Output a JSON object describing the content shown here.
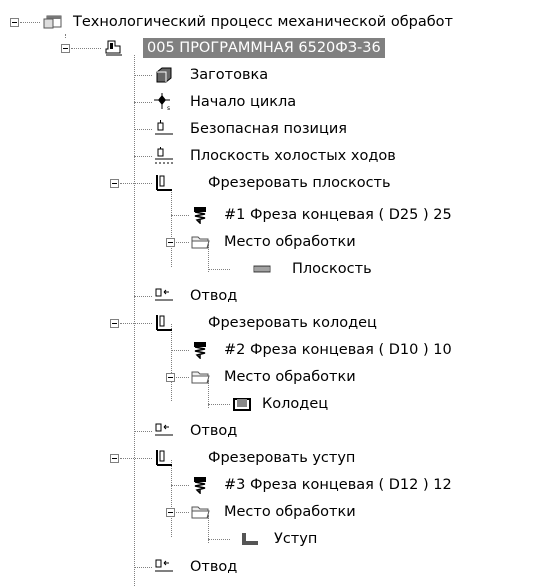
{
  "tree": {
    "root": {
      "label": "Технологический процесс механической обработ"
    },
    "operation": {
      "label": "005  ПРОГРАММНАЯ 6520ФЗ-36"
    },
    "items": {
      "zagotovka": "Заготовка",
      "nachalo": "Начало цикла",
      "bezopasnaya": "Безопасная позиция",
      "ploskost_hol": "Плоскость холостых ходов",
      "frez_ploskost": "Фрезеровать плоскость",
      "tool1": "#1 Фреза концевая ( D25 ) 25",
      "mesto1": "Место обработки",
      "ploskost": "Плоскость",
      "otvod1": "Отвод",
      "frez_kolodec": "Фрезеровать колодец",
      "tool2": "#2 Фреза концевая ( D10 ) 10",
      "mesto2": "Место обработки",
      "kolodec": "Колодец",
      "otvod2": "Отвод",
      "frez_ustup": "Фрезеровать уступ",
      "tool3": "#3 Фреза концевая ( D12 ) 12",
      "mesto3": "Место обработки",
      "ustup": "Уступ",
      "otvod3": "Отвод"
    }
  }
}
